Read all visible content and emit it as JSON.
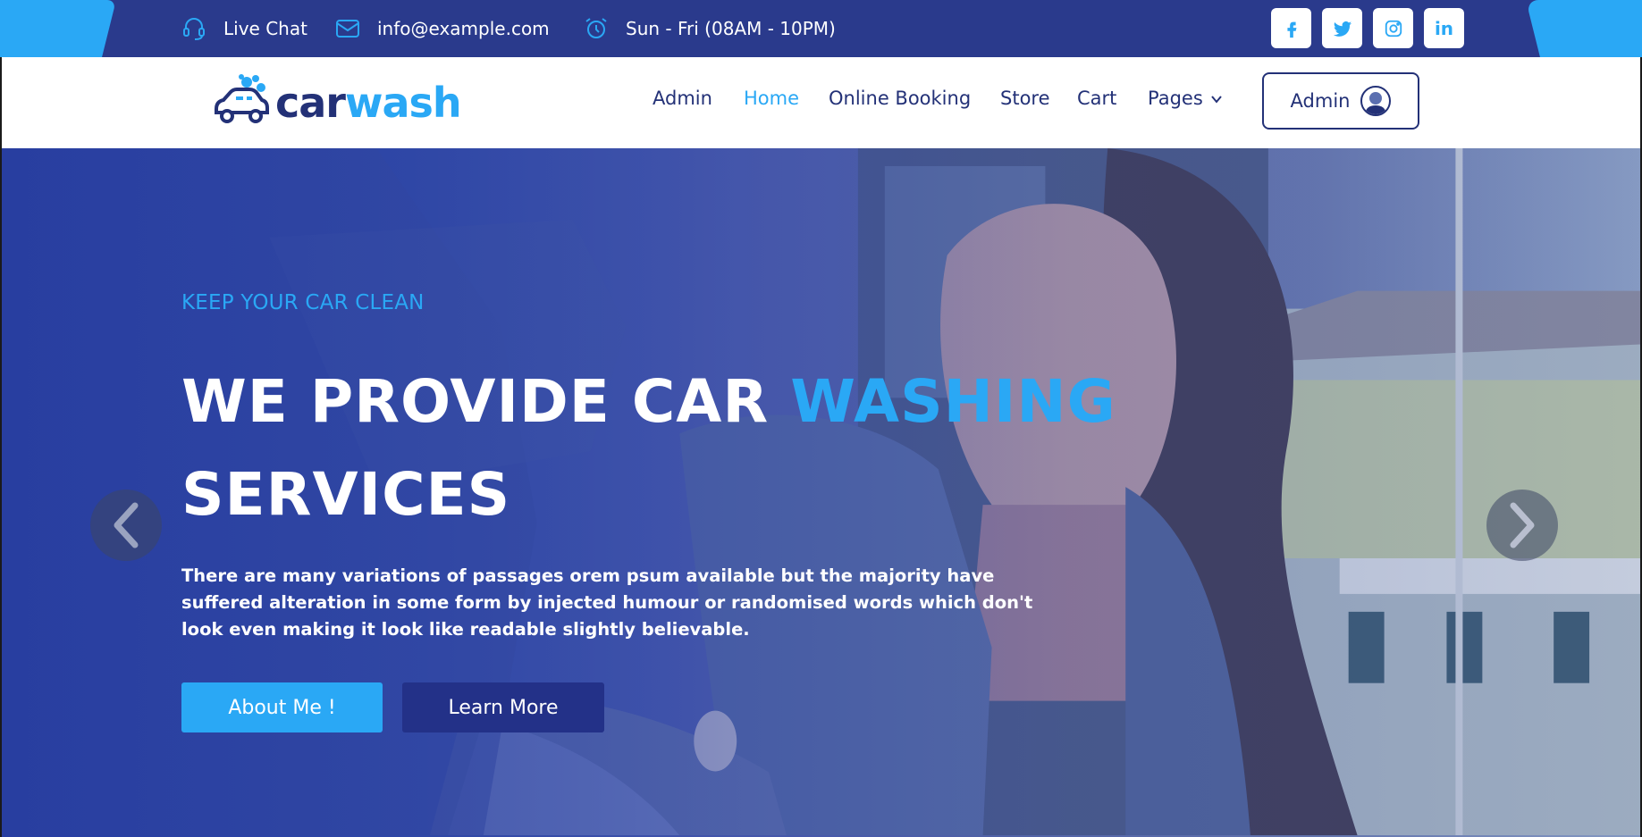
{
  "topbar": {
    "live_chat": "Live Chat",
    "email": "info@example.com",
    "hours": "Sun - Fri (08AM - 10PM)",
    "socials": [
      {
        "name": "facebook-icon"
      },
      {
        "name": "twitter-icon"
      },
      {
        "name": "instagram-icon"
      },
      {
        "name": "linkedin-icon",
        "label": "in"
      }
    ]
  },
  "header": {
    "logo_car": "car",
    "logo_wash": "wash",
    "nav": [
      "Admin",
      "Home",
      "Online Booking",
      "Store",
      "Cart",
      "Pages"
    ],
    "active_nav": "Home",
    "admin_button": "Admin"
  },
  "hero": {
    "eyebrow": "KEEP YOUR CAR CLEAN",
    "headline_part1": "WE PROVIDE CAR ",
    "headline_accent": "WASHING",
    "headline_part2": "SERVICES",
    "lead": "There are many variations of passages orem psum available but the majority have suffered alteration in some form by injected humour or randomised words which don't look even making it look like readable slightly believable.",
    "about_button": "About Me !",
    "learn_button": "Learn More"
  },
  "colors": {
    "primary_dark": "#233177",
    "accent": "#2aa8f5",
    "topbar_bg": "#2a3a8c"
  }
}
